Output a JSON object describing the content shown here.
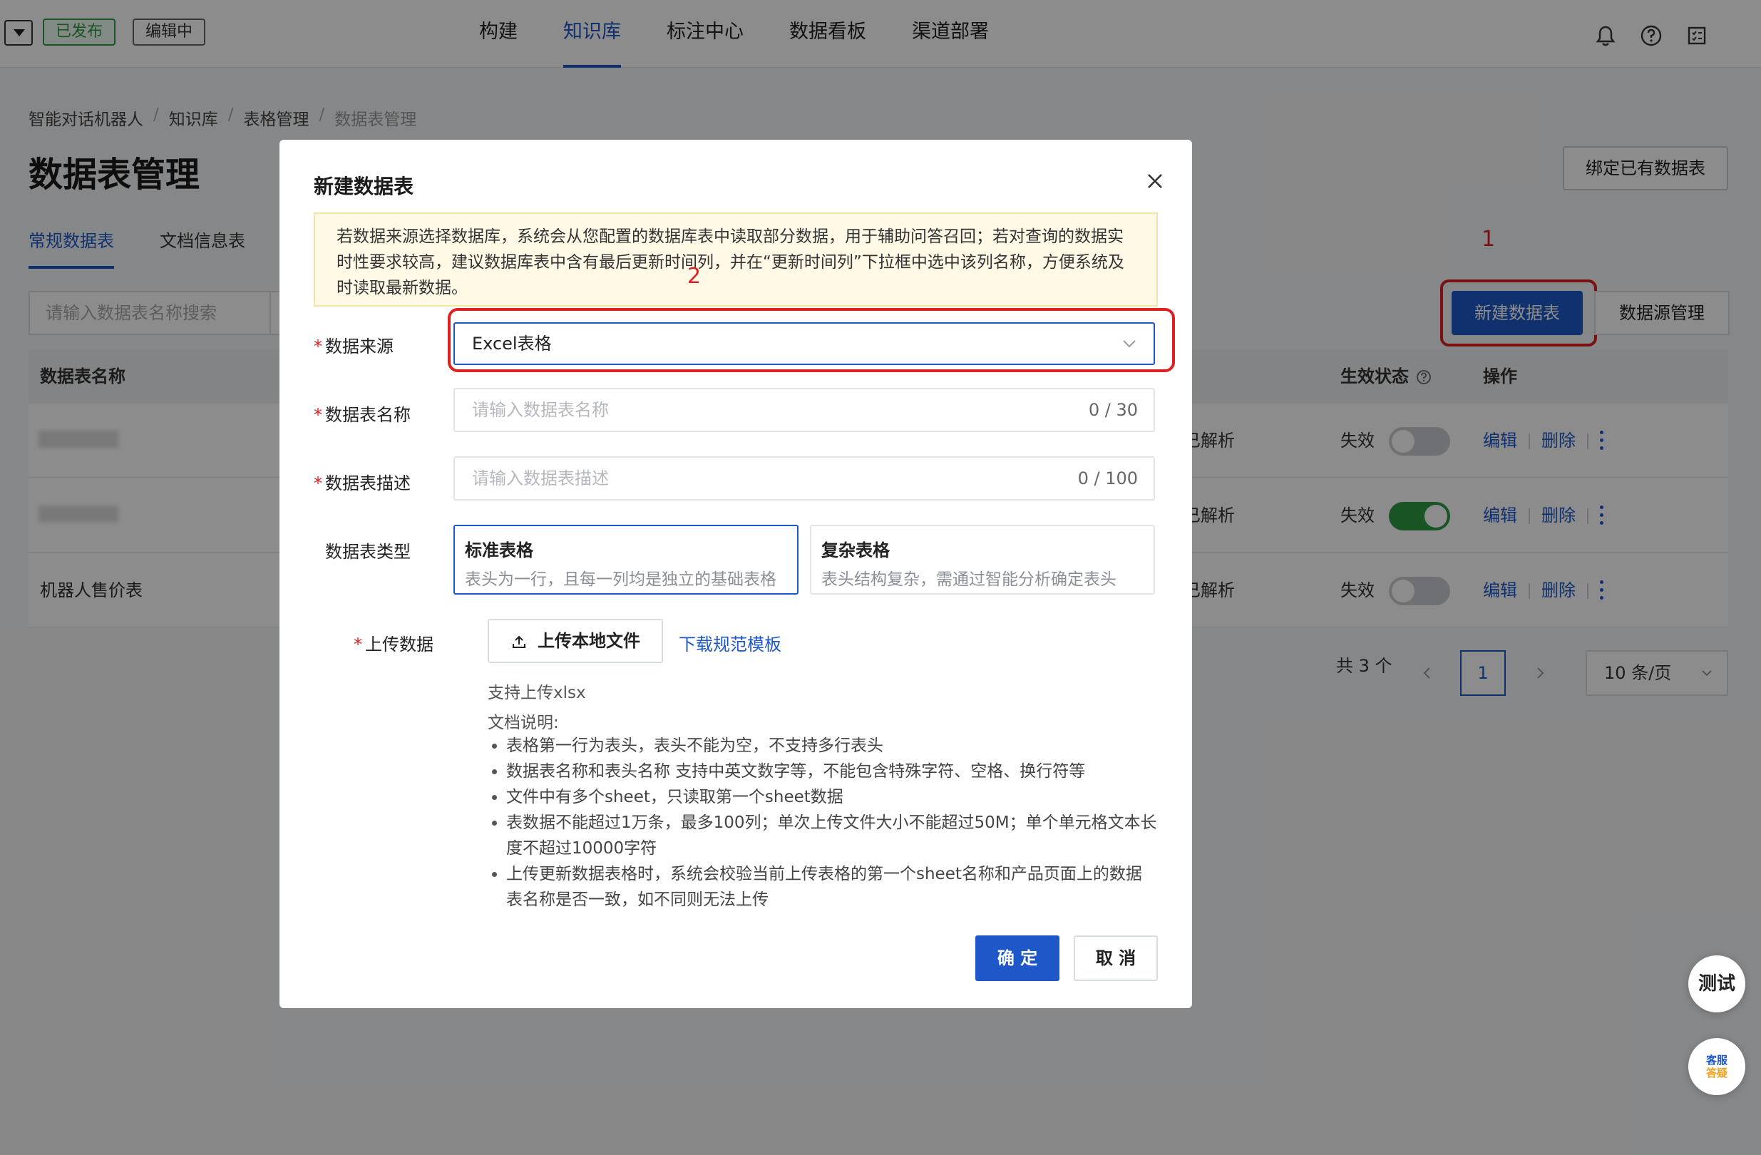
{
  "header": {
    "status_published": "已发布",
    "status_editing": "编辑中",
    "nav": [
      "构建",
      "知识库",
      "标注中心",
      "数据看板",
      "渠道部署"
    ],
    "active_nav": "知识库"
  },
  "breadcrumb": [
    "智能对话机器人",
    "知识库",
    "表格管理",
    "数据表管理"
  ],
  "page": {
    "title": "数据表管理",
    "bind_button": "绑定已有数据表",
    "tabs": [
      "常规数据表",
      "文档信息表"
    ],
    "search_placeholder": "请输入数据表名称搜索",
    "new_button": "新建数据表",
    "source_button": "数据源管理",
    "annotation_1": "1",
    "columns": {
      "name": "数据表名称",
      "status": "生效状态",
      "actions": "操作"
    },
    "rows": [
      {
        "name": "",
        "parse": "已解析",
        "status": "失效",
        "enabled": false
      },
      {
        "name": "",
        "parse": "已解析",
        "status": "失效",
        "enabled": true
      },
      {
        "name": "机器人售价表",
        "parse": "已解析",
        "status": "失效",
        "enabled": false
      }
    ],
    "edit_label": "编辑",
    "delete_label": "删除",
    "pager": {
      "total": "共 3 个",
      "current": "1",
      "size": "10 条/页"
    },
    "float_test": "测试",
    "float_service_1": "客服",
    "float_service_2": "答疑"
  },
  "modal": {
    "title": "新建数据表",
    "notice": "若数据来源选择数据库，系统会从您配置的数据库表中读取部分数据，用于辅助问答召回；若对查询的数据实时性要求较高，建议数据库表中含有最后更新时间列，并在“更新时间列”下拉框中选中该列名称，方便系统及时读取最新数据。",
    "annotation_2": "2",
    "source_label": "数据来源",
    "source_value": "Excel表格",
    "name_label": "数据表名称",
    "name_placeholder": "请输入数据表名称",
    "name_count": "0 / 30",
    "desc_label": "数据表描述",
    "desc_placeholder": "请输入数据表描述",
    "desc_count": "0 / 100",
    "type_label": "数据表类型",
    "types": [
      {
        "title": "标准表格",
        "desc": "表头为一行，且每一列均是独立的基础表格"
      },
      {
        "title": "复杂表格",
        "desc": "表头结构复杂，需通过智能分析确定表头"
      }
    ],
    "upload_label": "上传数据",
    "upload_button": "上传本地文件",
    "download_link": "下载规范模板",
    "support_text": "支持上传xlsx",
    "doc_title": "文档说明:",
    "doc_items": [
      "表格第一行为表头，表头不能为空，不支持多行表头",
      "数据表名称和表头名称 支持中英文数字等，不能包含特殊字符、空格、换行符等",
      "文件中有多个sheet，只读取第一个sheet数据",
      "表数据不能超过1万条，最多100列；单次上传文件大小不能超过50M；单个单元格文本长度不超过10000字符",
      "上传更新数据表格时，系统会校验当前上传表格的第一个sheet名称和产品页面上的数据表名称是否一致，如不同则无法上传"
    ],
    "ok_button": "确 定",
    "cancel_button": "取 消"
  }
}
